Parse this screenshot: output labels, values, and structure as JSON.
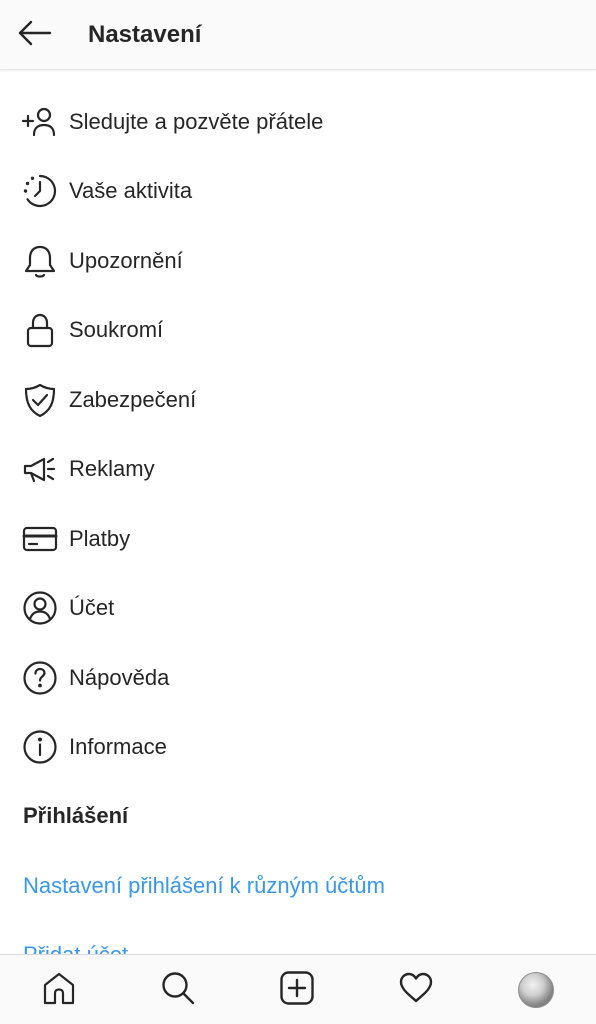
{
  "header": {
    "title": "Nastavení",
    "back_icon": "arrow-left-icon"
  },
  "menu": {
    "items": [
      {
        "label": "Sledujte a pozvěte přátele",
        "icon": "add-person-icon"
      },
      {
        "label": "Vaše aktivita",
        "icon": "activity-clock-icon"
      },
      {
        "label": "Upozornění",
        "icon": "bell-icon"
      },
      {
        "label": "Soukromí",
        "icon": "lock-icon"
      },
      {
        "label": "Zabezpečení",
        "icon": "shield-check-icon"
      },
      {
        "label": "Reklamy",
        "icon": "megaphone-icon"
      },
      {
        "label": "Platby",
        "icon": "credit-card-icon"
      },
      {
        "label": "Účet",
        "icon": "account-circle-icon"
      },
      {
        "label": "Nápověda",
        "icon": "help-circle-icon"
      },
      {
        "label": "Informace",
        "icon": "info-circle-icon"
      }
    ]
  },
  "login_section": {
    "title": "Přihlášení",
    "multi_account_link": "Nastavení přihlášení k různým účtům",
    "add_account_link": "Přidat účet"
  },
  "bottom_nav": {
    "items": [
      "home-icon",
      "search-icon",
      "new-post-icon",
      "heart-icon",
      "profile-avatar"
    ]
  },
  "colors": {
    "text": "#262626",
    "link": "#3897f0",
    "bar_background": "#fafafa",
    "divider": "#dbdbdb"
  }
}
